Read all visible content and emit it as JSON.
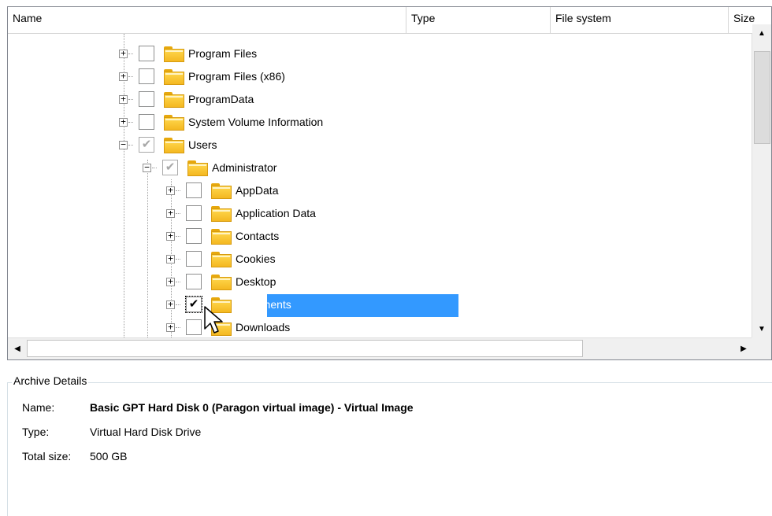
{
  "columns": {
    "name": "Name",
    "type": "Type",
    "file_system": "File system",
    "size": "Size"
  },
  "tree": {
    "rows": [
      {
        "label": "Program Files",
        "checked": false
      },
      {
        "label": "Program Files (x86)",
        "checked": false
      },
      {
        "label": "ProgramData",
        "checked": false
      },
      {
        "label": "System Volume Information",
        "checked": false
      },
      {
        "label": "Users",
        "checked": "partial"
      },
      {
        "label": "Administrator",
        "checked": "partial"
      },
      {
        "label": "AppData",
        "checked": false
      },
      {
        "label": "Application Data",
        "checked": false
      },
      {
        "label": "Contacts",
        "checked": false
      },
      {
        "label": "Cookies",
        "checked": false
      },
      {
        "label": "Desktop",
        "checked": false
      },
      {
        "label": "Documents",
        "checked": true,
        "selected": true
      },
      {
        "label": "Downloads",
        "checked": false
      }
    ],
    "expander_plus": "+",
    "expander_minus": "−",
    "check_mark": "✔"
  },
  "scrollbar": {
    "up": "▲",
    "down": "▼",
    "left": "◀",
    "right": "▶"
  },
  "details": {
    "legend": "Archive Details",
    "name_label": "Name:",
    "name_value": "Basic GPT Hard Disk 0 (Paragon virtual image) - Virtual Image",
    "type_label": "Type:",
    "type_value": "Virtual Hard Disk Drive",
    "size_label": "Total size:",
    "size_value": "500 GB"
  },
  "colors": {
    "selection": "#3399ff",
    "folder": "#f4b820"
  }
}
